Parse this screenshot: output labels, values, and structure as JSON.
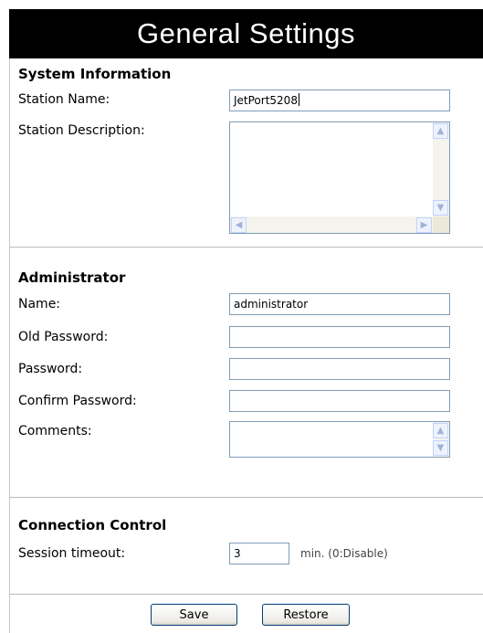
{
  "page": {
    "title": "General Settings"
  },
  "system_information": {
    "heading": "System Information",
    "station_name": {
      "label": "Station Name:",
      "value": "JetPort5208"
    },
    "station_description": {
      "label": "Station Description:",
      "value": ""
    }
  },
  "administrator": {
    "heading": "Administrator",
    "name": {
      "label": "Name:",
      "value": "administrator"
    },
    "old_password": {
      "label": "Old Password:",
      "value": ""
    },
    "password": {
      "label": "Password:",
      "value": ""
    },
    "confirm_password": {
      "label": "Confirm Password:",
      "value": ""
    },
    "comments": {
      "label": "Comments:",
      "value": ""
    }
  },
  "connection_control": {
    "heading": "Connection Control",
    "session_timeout": {
      "label": "Session timeout:",
      "value": "3",
      "hint": "min. (0:Disable)"
    }
  },
  "buttons": {
    "save": "Save",
    "restore": "Restore"
  },
  "icons": {
    "scroll_up": "▲",
    "scroll_down": "▼",
    "scroll_left": "◀",
    "scroll_right": "▶"
  }
}
